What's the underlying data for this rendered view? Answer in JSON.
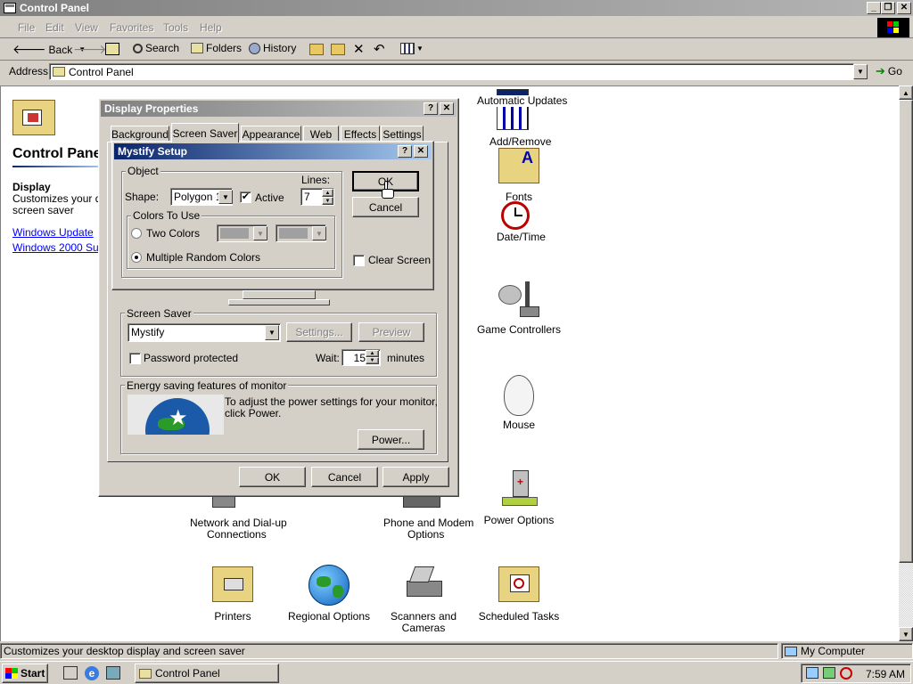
{
  "window": {
    "title": "Control Panel"
  },
  "menu": [
    "File",
    "Edit",
    "View",
    "Favorites",
    "Tools",
    "Help"
  ],
  "toolbar": {
    "back": "Back",
    "search": "Search",
    "folders": "Folders",
    "history": "History"
  },
  "address": {
    "label": "Address",
    "value": "Control Panel",
    "go": "Go"
  },
  "left_panel": {
    "title": "Control Panel",
    "heading": "Display",
    "desc_line1": "Customizes your des",
    "desc_line2": "screen saver",
    "link1": "Windows Update",
    "link2": "Windows 2000 Supp"
  },
  "icons": {
    "auto_updates": "Automatic Updates",
    "add_remove": "Add/Remove",
    "fonts_label": "Fonts",
    "date_time": "Date/Time",
    "game_controllers": "Game Controllers",
    "mouse": "Mouse",
    "power_options": "Power Options",
    "network_1": "Network and Dial-up",
    "network_2": "Connections",
    "phone_1": "Phone and Modem",
    "phone_2": "Options",
    "printers": "Printers",
    "regional": "Regional Options",
    "scanners_1": "Scanners and",
    "scanners_2": "Cameras",
    "scheduled": "Scheduled Tasks"
  },
  "display_props": {
    "title": "Display Properties",
    "tabs": [
      "Background",
      "Screen Saver",
      "Appearance",
      "Web",
      "Effects",
      "Settings"
    ],
    "screen_saver_group": "Screen Saver",
    "screen_saver_value": "Mystify",
    "settings_btn": "Settings...",
    "preview_btn": "Preview",
    "password": "Password protected",
    "wait_label": "Wait:",
    "wait_value": "15",
    "minutes": "minutes",
    "energy_group": "Energy saving features of monitor",
    "energy_text1": "To adjust the power settings for your monitor,",
    "energy_text2": "click Power.",
    "power_btn": "Power...",
    "ok": "OK",
    "cancel": "Cancel",
    "apply": "Apply"
  },
  "mystify": {
    "title": "Mystify Setup",
    "object_group": "Object",
    "shape_label": "Shape:",
    "shape_value": "Polygon 1",
    "active": "Active",
    "lines_label": "Lines:",
    "lines_value": "7",
    "colors_group": "Colors To Use",
    "two_colors": "Two Colors",
    "multi_colors": "Multiple Random Colors",
    "clear_screen": "Clear Screen",
    "ok": "OK",
    "cancel": "Cancel"
  },
  "status": {
    "text": "Customizes your desktop display and screen saver",
    "zone": "My Computer"
  },
  "taskbar": {
    "start": "Start",
    "task": "Control Panel",
    "clock": "7:59 AM"
  },
  "colors": {
    "title_active": "#0a246a",
    "title_inactive": "#808080",
    "desktop_bg": "#ffffff"
  }
}
